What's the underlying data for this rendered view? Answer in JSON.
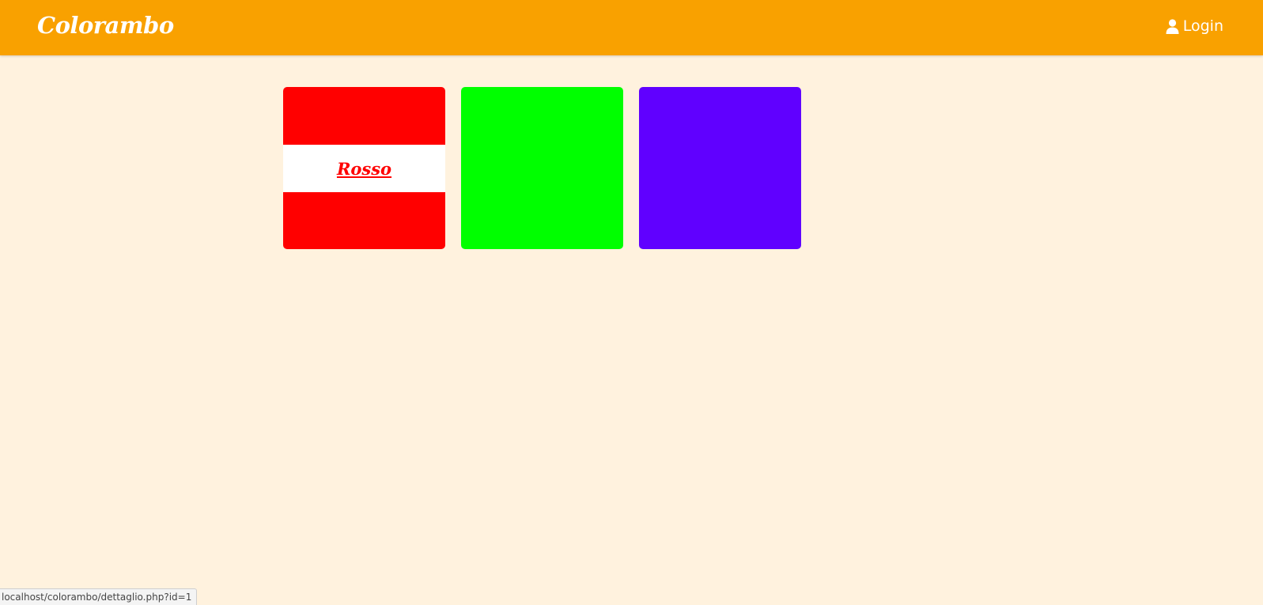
{
  "header": {
    "brand": "Colorambo",
    "login_label": "Login",
    "login_icon": "user-icon",
    "background": "#f9a100"
  },
  "page": {
    "background": "#fff2de"
  },
  "cards": [
    {
      "color": "#ff0000",
      "label": "Rosso",
      "label_visible": true
    },
    {
      "color": "#00ff00",
      "label_visible": false
    },
    {
      "color": "#6000ff",
      "label_visible": false
    }
  ],
  "statusbar": {
    "url": "localhost/colorambo/dettaglio.php?id=1"
  }
}
